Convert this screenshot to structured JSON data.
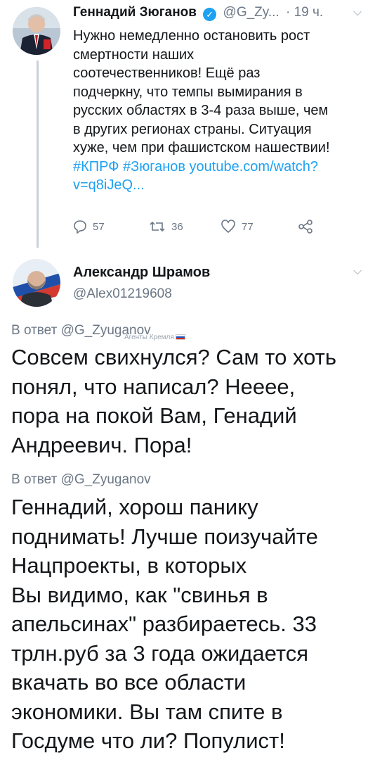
{
  "tweet": {
    "author": "Геннадий Зюганов",
    "handle": "@G_Zy...",
    "time": "· 19 ч.",
    "body_lines": [
      "Нужно немедленно остановить рост",
      "смертности наших",
      "соотечественников! Ещё раз",
      "подчеркну, что темпы вымирания в",
      "русских областях в 3-4 раза выше, чем",
      "в других регионах страны. Ситуация",
      "хуже, чем при фашистском нашествии!"
    ],
    "links_line": "#КПРФ #Зюганов youtube.com/watch?",
    "links_line2": "v=q8iJeQ...",
    "counts": {
      "replies": "57",
      "retweets": "36",
      "likes": "77"
    }
  },
  "reply": {
    "author": "Александр Шрамов",
    "handle": "@Alex01219608",
    "reply_to_1": "В ответ @G_Zyuganov",
    "agent_tag": "Агенты Кремля",
    "comment_1_lines": [
      "Совсем свихнулся? Сам то хоть",
      "понял, что написал? Нееее,",
      "пора на покой Вам, Генадий",
      "Андреевич. Пора!"
    ],
    "reply_to_2": "В ответ @G_Zyuganov",
    "comment_2_lines": [
      "Геннадий, хорош панику",
      "поднимать! Лучше поизучайте",
      "Нацпроекты, в которых",
      "Вы видимо, как \"свинья в",
      "апельсинах\" разбираетесь. 33",
      "трлн.руб за 3 года ожидается",
      "вкачать во все области",
      "экономики. Вы там спите в",
      "Госдуме что ли? Популист!"
    ]
  },
  "icons": {
    "chevron": "chevron-down-icon",
    "verified": "verified-badge-icon",
    "reply": "reply-icon",
    "retweet": "retweet-icon",
    "like": "heart-icon",
    "share": "share-icon"
  },
  "colors": {
    "link": "#1da1f2",
    "muted": "#6b7785",
    "text": "#14171a"
  }
}
